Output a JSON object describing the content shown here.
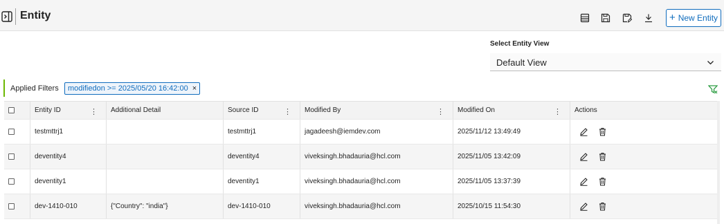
{
  "header": {
    "title": "Entity",
    "new_button": "New Entity",
    "toolbar_icons": [
      "list-view-icon",
      "save-icon",
      "save-as-icon",
      "download-icon"
    ]
  },
  "view_selector": {
    "label": "Select Entity View",
    "value": "Default View"
  },
  "filters": {
    "label": "Applied Filters",
    "chips": [
      {
        "text": "modifiedon >= 2025/05/20 16:42:00",
        "close": "×"
      }
    ]
  },
  "table": {
    "columns": [
      "Entity ID",
      "Additional Detail",
      "Source ID",
      "Modified By",
      "Modified On",
      "Actions"
    ],
    "rows": [
      {
        "entity_id": "testmttrj1",
        "additional_detail": "",
        "source_id": "testmttrj1",
        "modified_by": "jagadeesh@iemdev.com",
        "modified_on": "2025/11/12 13:49:49"
      },
      {
        "entity_id": "deventity4",
        "additional_detail": "",
        "source_id": "deventity4",
        "modified_by": "viveksingh.bhadauria@hcl.com",
        "modified_on": "2025/11/05 13:42:09"
      },
      {
        "entity_id": "deventity1",
        "additional_detail": "",
        "source_id": "deventity1",
        "modified_by": "viveksingh.bhadauria@hcl.com",
        "modified_on": "2025/11/05 13:37:39"
      },
      {
        "entity_id": "dev-1410-010",
        "additional_detail": "{\"Country\": \"india\"}",
        "source_id": "dev-1410-010",
        "modified_by": "viveksingh.bhadauria@hcl.com",
        "modified_on": "2025/10/15 11:54:30"
      }
    ]
  },
  "colors": {
    "accent": "#0f6cbd",
    "filter_green": "#6bb700"
  }
}
